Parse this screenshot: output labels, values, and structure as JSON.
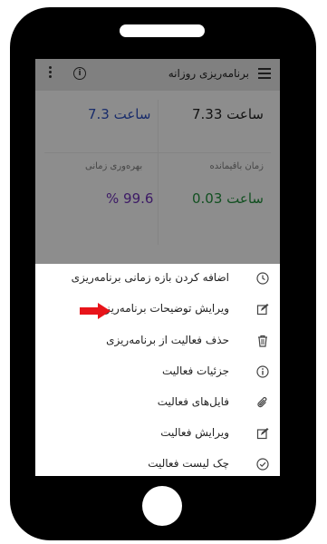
{
  "app_bar": {
    "title": "برنامه‌ریزی روزانه",
    "menu_icon": "hamburger-menu-icon",
    "info_icon": "info-icon",
    "more_icon": "more-vert-icon"
  },
  "stats": {
    "top_right_value": "7.33 ساعت",
    "top_left_value": "7.3 ساعت",
    "remaining_label": "زمان باقیمانده",
    "remaining_value": "0.03 ساعت",
    "efficiency_label": "بهره‌وری زمانی",
    "efficiency_value": "% 99.6"
  },
  "colors": {
    "blue_value": "#2b4db8",
    "green_value": "#1f8a3a",
    "purple_value": "#6a2fb0",
    "arrow": "#e8141a"
  },
  "bottom_sheet": {
    "items": [
      {
        "label": "اضافه کردن بازه زمانی برنامه‌ریزی",
        "icon": "clock-icon"
      },
      {
        "label": "ویرایش توضیحات برنامه‌ریزی",
        "icon": "edit-icon"
      },
      {
        "label": "حذف فعالیت از برنامه‌ریزی",
        "icon": "trash-icon"
      },
      {
        "label": "جزئیات فعالیت",
        "icon": "info-icon"
      },
      {
        "label": "فایل‌های فعالیت",
        "icon": "paperclip-icon"
      },
      {
        "label": "ویرایش فعالیت",
        "icon": "edit-icon"
      },
      {
        "label": "چک لیست فعالیت",
        "icon": "check-circle-icon"
      }
    ]
  }
}
